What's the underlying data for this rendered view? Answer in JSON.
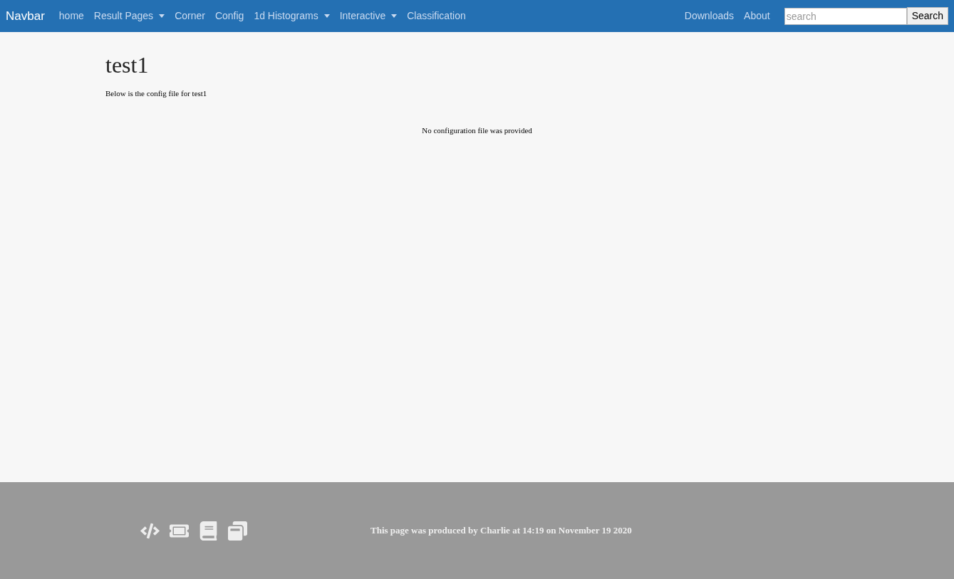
{
  "navbar": {
    "brand": "Navbar",
    "items": [
      {
        "label": "home",
        "dropdown": false
      },
      {
        "label": "Result Pages",
        "dropdown": true
      },
      {
        "label": "Corner",
        "dropdown": false
      },
      {
        "label": "Config",
        "dropdown": false
      },
      {
        "label": "1d Histograms",
        "dropdown": true
      },
      {
        "label": "Interactive",
        "dropdown": true
      },
      {
        "label": "Classification",
        "dropdown": false
      }
    ],
    "right_items": [
      "Downloads",
      "About"
    ],
    "search": {
      "placeholder": "search",
      "button": "Search"
    }
  },
  "main": {
    "title": "test1",
    "subtitle": "Below is the config file for test1",
    "message": "No configuration file was provided"
  },
  "footer": {
    "icons": [
      {
        "kind": "code"
      },
      {
        "kind": "ticket"
      },
      {
        "kind": "book"
      },
      {
        "kind": "windows"
      }
    ],
    "text": "This page was produced by Charlie at 14:19 on November 19 2020"
  }
}
